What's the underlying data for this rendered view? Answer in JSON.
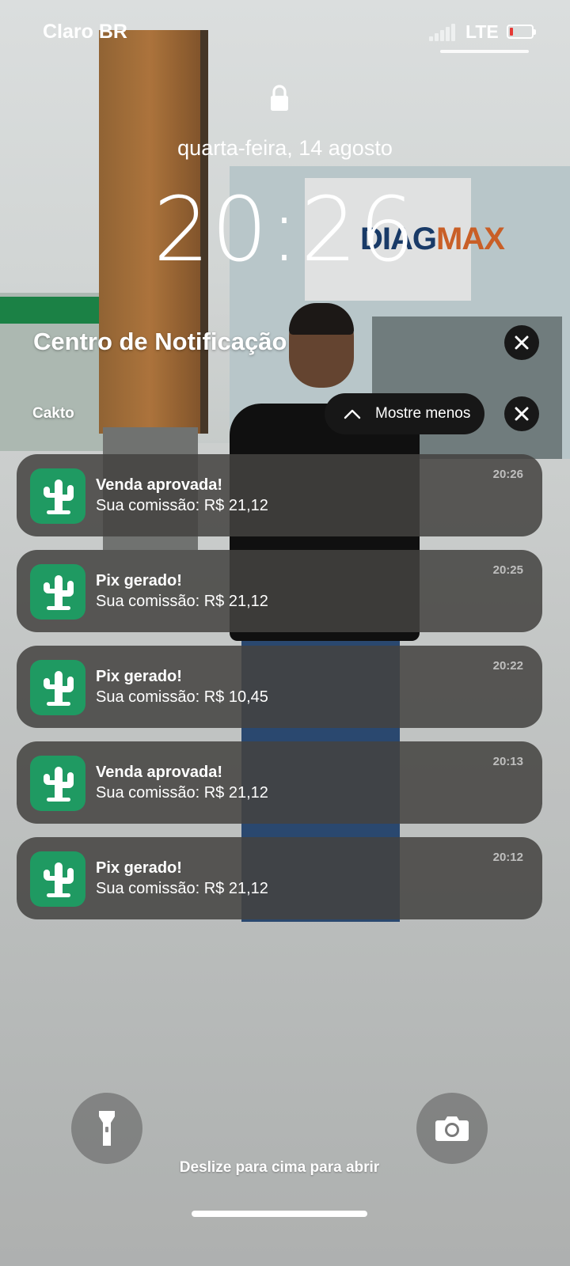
{
  "status_bar": {
    "carrier": "Claro BR",
    "network": "LTE",
    "battery_level": 0.15,
    "battery_color": "#e53935"
  },
  "lock_screen": {
    "lock_icon": "lock-icon",
    "date": "quarta-feira, 14 agosto",
    "time": "20:26"
  },
  "notification_center": {
    "title": "Centro de Notificação",
    "group": {
      "app_name": "Cakto",
      "show_less_label": "Mostre menos",
      "notifications": [
        {
          "title": "Venda aprovada!",
          "body": "Sua comissão: R$ 21,12",
          "time": "20:26"
        },
        {
          "title": "Pix gerado!",
          "body": "Sua comissão: R$ 21,12",
          "time": "20:25"
        },
        {
          "title": "Pix gerado!",
          "body": "Sua comissão: R$ 10,45",
          "time": "20:22"
        },
        {
          "title": "Venda aprovada!",
          "body": "Sua comissão: R$ 21,12",
          "time": "20:13"
        },
        {
          "title": "Pix gerado!",
          "body": "Sua comissão: R$ 21,12",
          "time": "20:12"
        }
      ],
      "app_icon": "cactus-icon",
      "app_color": "#1f9a62"
    }
  },
  "bottom": {
    "swipe_hint": "Deslize para cima para abrir",
    "flashlight_icon": "flashlight-icon",
    "camera_icon": "camera-icon"
  }
}
